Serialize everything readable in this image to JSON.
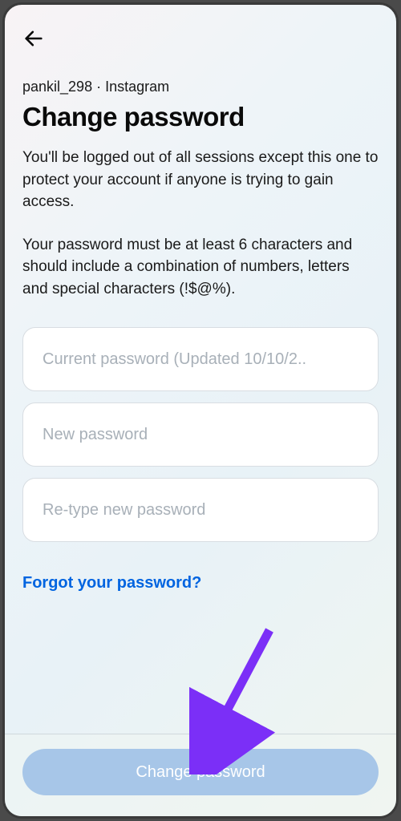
{
  "header": {
    "back_icon": "arrow-left"
  },
  "breadcrumb": {
    "username": "pankil_298",
    "separator": " · ",
    "app": "Instagram"
  },
  "page": {
    "title": "Change password",
    "description": "You'll be logged out of all sessions except this one to protect your account if anyone is trying to gain access.",
    "requirements": "Your password must be at least 6 characters and should include a combination of numbers, letters and special characters (!$@%)."
  },
  "form": {
    "current_password_placeholder": "Current password (Updated 10/10/2..",
    "new_password_placeholder": "New password",
    "retype_password_placeholder": "Re-type new password",
    "forgot_link_label": "Forgot your password?",
    "submit_label": "Change password"
  },
  "annotation": {
    "arrow_color": "#7b2ff7"
  }
}
